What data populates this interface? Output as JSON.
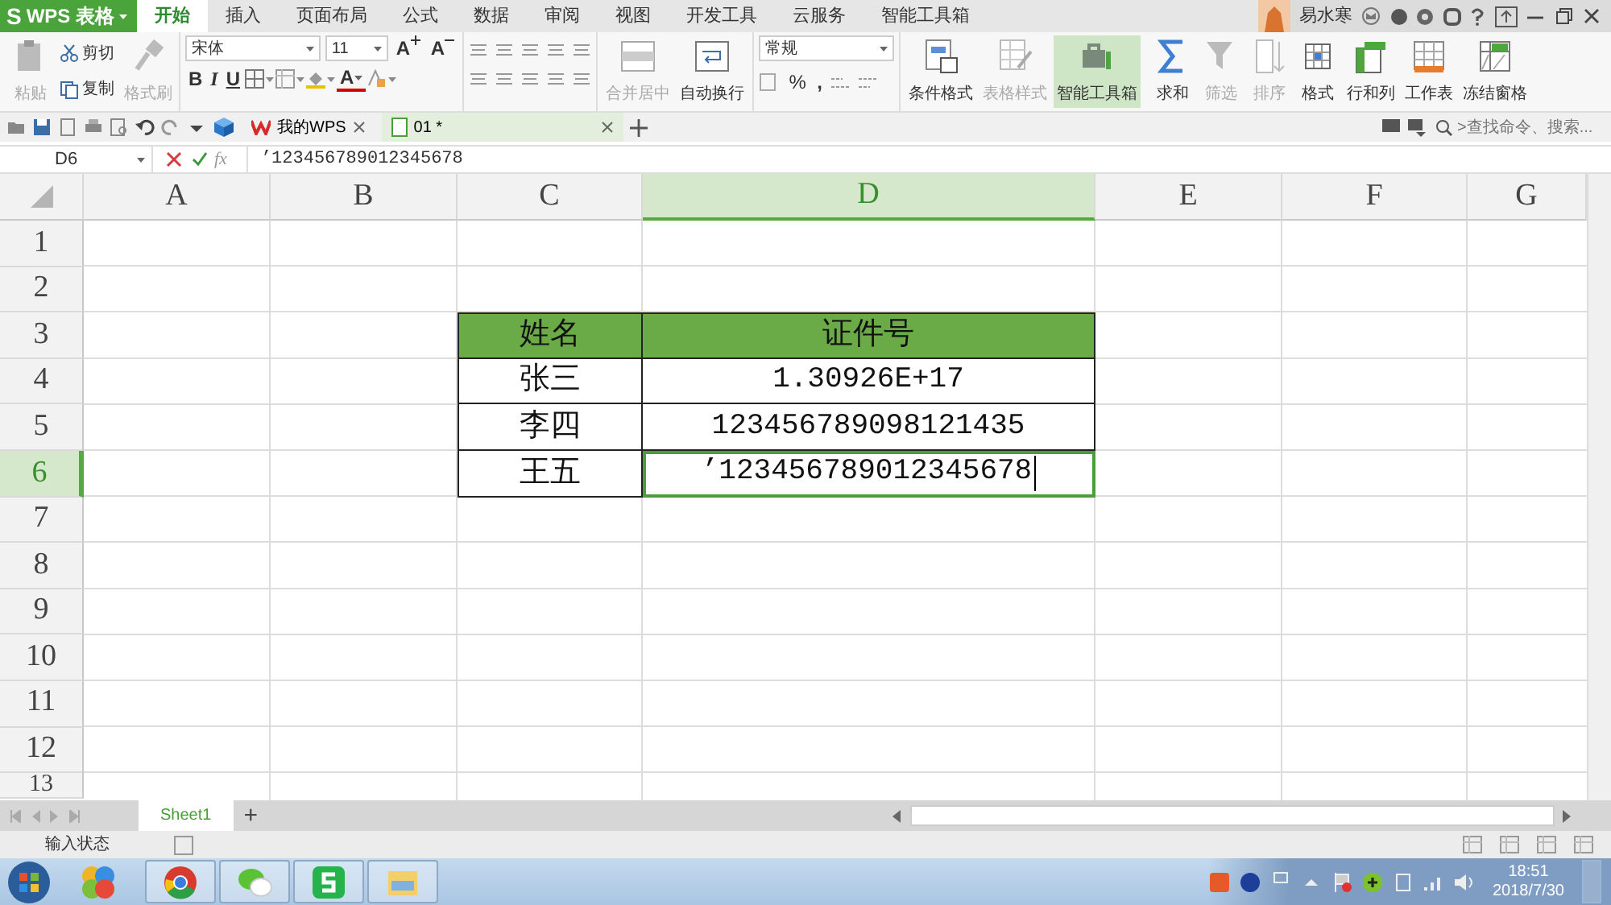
{
  "app": {
    "logo_mark": "S",
    "title": "WPS 表格"
  },
  "menu_tabs": [
    {
      "label": "开始",
      "selected": true
    },
    {
      "label": "插入",
      "selected": false
    },
    {
      "label": "页面布局",
      "selected": false
    },
    {
      "label": "公式",
      "selected": false
    },
    {
      "label": "数据",
      "selected": false
    },
    {
      "label": "审阅",
      "selected": false
    },
    {
      "label": "视图",
      "selected": false
    },
    {
      "label": "开发工具",
      "selected": false
    },
    {
      "label": "云服务",
      "selected": false
    },
    {
      "label": "智能工具箱",
      "selected": false
    }
  ],
  "user": {
    "name": "易水寒"
  },
  "ribbon": {
    "paste": {
      "label": "粘贴",
      "disabled": true
    },
    "cut": {
      "label": "剪切"
    },
    "copy": {
      "label": "复制"
    },
    "format_painter": {
      "label": "格式刷",
      "disabled": true
    },
    "font_name": "宋体",
    "font_size": "11",
    "grow_font": "A",
    "shrink_font": "A",
    "bold": "B",
    "italic": "I",
    "underline": "U",
    "font_color": "A",
    "merge_center": {
      "label": "合并居中",
      "disabled": true
    },
    "wrap_text": {
      "label": "自动换行",
      "disabled": false
    },
    "number_format": "常规",
    "percent": "%",
    "comma": ",",
    "big_buttons": [
      {
        "label": "条件格式",
        "disabled": false,
        "active": false
      },
      {
        "label": "表格样式",
        "disabled": true,
        "active": false
      },
      {
        "label": "智能工具箱",
        "disabled": false,
        "active": true
      },
      {
        "label": "求和",
        "disabled": false,
        "active": false
      },
      {
        "label": "筛选",
        "disabled": true,
        "active": false
      },
      {
        "label": "排序",
        "disabled": true,
        "active": false
      },
      {
        "label": "格式",
        "disabled": false,
        "active": false
      },
      {
        "label": "行和列",
        "disabled": false,
        "active": false
      },
      {
        "label": "工作表",
        "disabled": false,
        "active": false
      },
      {
        "label": "冻结窗格",
        "disabled": false,
        "active": false
      }
    ]
  },
  "doc_tabs": [
    {
      "label": "我的WPS",
      "selected": false
    },
    {
      "label": "01 *",
      "selected": true
    }
  ],
  "search": {
    "placeholder": ">查找命令、搜索..."
  },
  "formula_bar": {
    "cell_ref": "D6",
    "fx": "fx",
    "value": "’123456789012345678"
  },
  "columns": [
    {
      "label": "A",
      "selected": false
    },
    {
      "label": "B",
      "selected": false
    },
    {
      "label": "C",
      "selected": false
    },
    {
      "label": "D",
      "selected": true
    },
    {
      "label": "E",
      "selected": false
    },
    {
      "label": "F",
      "selected": false
    },
    {
      "label": "G",
      "selected": false
    }
  ],
  "rows": [
    {
      "label": "1",
      "selected": false
    },
    {
      "label": "2",
      "selected": false
    },
    {
      "label": "3",
      "selected": false
    },
    {
      "label": "4",
      "selected": false
    },
    {
      "label": "5",
      "selected": false
    },
    {
      "label": "6",
      "selected": true
    },
    {
      "label": "7",
      "selected": false
    },
    {
      "label": "8",
      "selected": false
    },
    {
      "label": "9",
      "selected": false
    },
    {
      "label": "10",
      "selected": false
    },
    {
      "label": "11",
      "selected": false
    },
    {
      "label": "12",
      "selected": false
    },
    {
      "label": "13",
      "selected": false
    }
  ],
  "data_table": {
    "header": [
      "姓名",
      "证件号"
    ],
    "rows": [
      {
        "cells": [
          "张三",
          "1.30926E+17"
        ],
        "selected": false
      },
      {
        "cells": [
          "李四",
          "123456789098121435"
        ],
        "selected": false
      },
      {
        "cells": [
          "王五",
          "’123456789012345678"
        ],
        "selected": true
      }
    ]
  },
  "sheet_tabs": [
    {
      "label": "Sheet1",
      "selected": true
    }
  ],
  "add_sheet": "+",
  "status": {
    "text": "输入状态"
  },
  "clock": {
    "time": "18:51",
    "date": "2018/7/30"
  }
}
